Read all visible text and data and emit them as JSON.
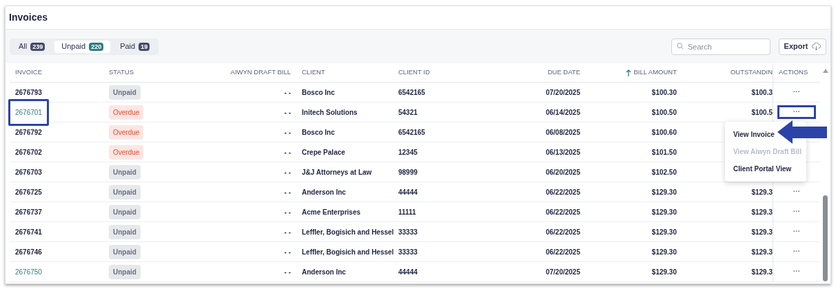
{
  "page": {
    "title": "Invoices"
  },
  "tabs": [
    {
      "label": "All",
      "count": "239",
      "selected": false
    },
    {
      "label": "Unpaid",
      "count": "220",
      "selected": true
    },
    {
      "label": "Paid",
      "count": "19",
      "selected": false
    }
  ],
  "search": {
    "placeholder": "Search"
  },
  "export_button": "Export",
  "table": {
    "columns": [
      {
        "label": "INVOICE",
        "sorted": false
      },
      {
        "label": "STATUS",
        "sorted": false
      },
      {
        "label": "AIWYN DRAFT BILL",
        "sorted": false
      },
      {
        "label": "CLIENT",
        "sorted": false
      },
      {
        "label": "CLIENT ID",
        "sorted": false
      },
      {
        "label": "DUE DATE",
        "sorted": false
      },
      {
        "label": "BILL AMOUNT",
        "sorted": true
      },
      {
        "label": "OUTSTANDIN",
        "sorted": false
      },
      {
        "label": "ACTIONS",
        "sorted": false
      }
    ],
    "rows": [
      {
        "invoice": "2676793",
        "link": false,
        "highlighted": false,
        "status": "Unpaid",
        "overdue": false,
        "draft_bill": "- -",
        "client": "Bosco Inc",
        "client_id": "6542165",
        "due_date": "07/20/2025",
        "bill_amount": "$100.30",
        "outstanding": "$100.3",
        "actions": "···"
      },
      {
        "invoice": "2676701",
        "link": true,
        "highlighted": true,
        "status": "Overdue",
        "overdue": true,
        "draft_bill": "- -",
        "client": "Initech Solutions",
        "client_id": "54321",
        "due_date": "06/14/2025",
        "bill_amount": "$100.50",
        "outstanding": "$100.5",
        "actions": "···"
      },
      {
        "invoice": "2676792",
        "link": false,
        "highlighted": false,
        "status": "Overdue",
        "overdue": true,
        "draft_bill": "- -",
        "client": "Bosco Inc",
        "client_id": "6542165",
        "due_date": "06/08/2025",
        "bill_amount": "$100.60"
      },
      {
        "invoice": "2676702",
        "link": false,
        "highlighted": false,
        "status": "Overdue",
        "overdue": true,
        "draft_bill": "- -",
        "client": "Crepe Palace",
        "client_id": "12345",
        "due_date": "06/13/2025",
        "bill_amount": "$101.50"
      },
      {
        "invoice": "2676703",
        "link": false,
        "highlighted": false,
        "status": "Unpaid",
        "overdue": false,
        "draft_bill": "- -",
        "client": "J&J Attorneys at Law",
        "client_id": "98999",
        "due_date": "06/20/2025",
        "bill_amount": "$102.50"
      },
      {
        "invoice": "2676725",
        "link": false,
        "highlighted": false,
        "status": "Unpaid",
        "overdue": false,
        "draft_bill": "- -",
        "client": "Anderson Inc",
        "client_id": "44444",
        "due_date": "06/22/2025",
        "bill_amount": "$129.30",
        "outstanding": "$129.3",
        "actions": "···"
      },
      {
        "invoice": "2676737",
        "link": false,
        "highlighted": false,
        "status": "Unpaid",
        "overdue": false,
        "draft_bill": "- -",
        "client": "Acme Enterprises",
        "client_id": "11111",
        "due_date": "06/22/2025",
        "bill_amount": "$129.30",
        "outstanding": "$129.3",
        "actions": "···"
      },
      {
        "invoice": "2676741",
        "link": false,
        "highlighted": false,
        "status": "Unpaid",
        "overdue": false,
        "draft_bill": "- -",
        "client": "Leffler, Bogisich and Hessel",
        "client_id": "33333",
        "due_date": "06/22/2025",
        "bill_amount": "$129.30",
        "outstanding": "$129.3",
        "actions": "···"
      },
      {
        "invoice": "2676746",
        "link": false,
        "highlighted": false,
        "status": "Unpaid",
        "overdue": false,
        "draft_bill": "- -",
        "client": "Leffler, Bogisich and Hessel",
        "client_id": "33333",
        "due_date": "06/22/2025",
        "bill_amount": "$129.30",
        "outstanding": "$129.3",
        "actions": "···"
      },
      {
        "invoice": "2676750",
        "link": true,
        "highlighted": false,
        "status": "Unpaid",
        "overdue": false,
        "draft_bill": "- -",
        "client": "Anderson Inc",
        "client_id": "44444",
        "due_date": "07/20/2025",
        "bill_amount": "$129.30",
        "outstanding": "$129.3",
        "actions": "···"
      }
    ]
  },
  "action_menu": {
    "items": [
      {
        "label": "View Invoice",
        "disabled": false,
        "pointed": true
      },
      {
        "label": "View Aiwyn Draft Bill",
        "disabled": true,
        "pointed": false
      },
      {
        "label": "Client Portal View",
        "disabled": false,
        "pointed": false
      }
    ]
  }
}
